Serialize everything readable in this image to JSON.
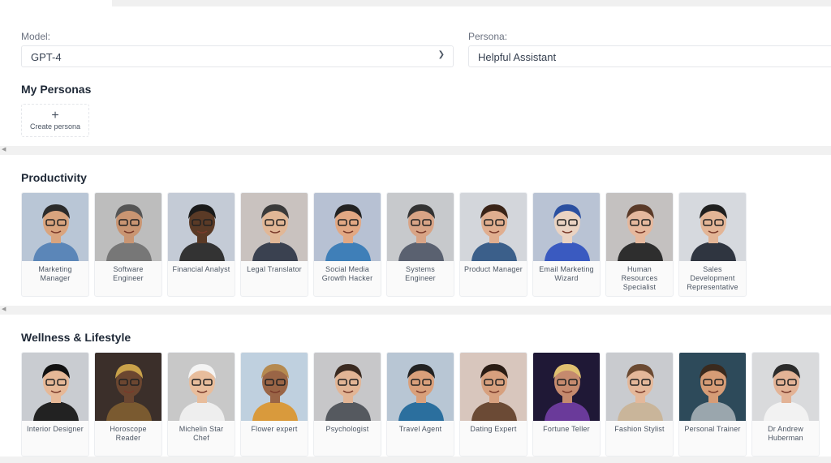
{
  "model": {
    "label": "Model:",
    "value": "GPT-4"
  },
  "persona": {
    "label": "Persona:",
    "value": "Helpful Assistant"
  },
  "my_personas": {
    "title": "My Personas",
    "create_label": "Create persona"
  },
  "sections": [
    {
      "title": "Productivity",
      "items": [
        {
          "name": "Marketing Manager",
          "bg": "#b9c6d6",
          "skin": "#d9a47e",
          "hair": "#2b2b2b",
          "shirt": "#5b86b8"
        },
        {
          "name": "Software Engineer",
          "bg": "#bdbdbd",
          "skin": "#c99572",
          "hair": "#555",
          "shirt": "#777"
        },
        {
          "name": "Financial Analyst",
          "bg": "#c4cbd6",
          "skin": "#5a3a26",
          "hair": "#1a1a1a",
          "shirt": "#333"
        },
        {
          "name": "Legal Translator",
          "bg": "#c9c2bf",
          "skin": "#e1b796",
          "hair": "#3a3a3a",
          "shirt": "#3a4150"
        },
        {
          "name": "Social Media Growth Hacker",
          "bg": "#b7c1d3",
          "skin": "#e2a883",
          "hair": "#222",
          "shirt": "#3f7fb8"
        },
        {
          "name": "Systems Engineer",
          "bg": "#c7c9cc",
          "skin": "#d8a486",
          "hair": "#333",
          "shirt": "#5a6170"
        },
        {
          "name": "Product Manager",
          "bg": "#d3d6db",
          "skin": "#e0ae8f",
          "hair": "#3a2418",
          "shirt": "#3b5f8a"
        },
        {
          "name": "Email Marketing Wizard",
          "bg": "#b9c3d4",
          "skin": "#ead3c2",
          "hair": "#2a4fa0",
          "shirt": "#3a5ac0"
        },
        {
          "name": "Human Resources Specialist",
          "bg": "#c4c1c0",
          "skin": "#e5b89d",
          "hair": "#5a3a28",
          "shirt": "#2e2e2e"
        },
        {
          "name": "Sales Development Representative",
          "bg": "#d6d9de",
          "skin": "#e3b596",
          "hair": "#1f1f1f",
          "shirt": "#2f3540"
        }
      ]
    },
    {
      "title": "Wellness & Lifestyle",
      "items": [
        {
          "name": "Interior Designer",
          "bg": "#c9ccd1",
          "skin": "#e6b897",
          "hair": "#111",
          "shirt": "#222"
        },
        {
          "name": "Horoscope Reader",
          "bg": "#3b2f2a",
          "skin": "#6b4630",
          "hair": "#c9a24a",
          "shirt": "#7a5a30"
        },
        {
          "name": "Michelin Star Chef",
          "bg": "#c8c8c8",
          "skin": "#e8bd9c",
          "hair": "#f4f4f4",
          "shirt": "#eeeeee"
        },
        {
          "name": "Flower expert",
          "bg": "#bfd0df",
          "skin": "#9a6546",
          "hair": "#b58a50",
          "shirt": "#d99a3c"
        },
        {
          "name": "Psychologist",
          "bg": "#c7c7c9",
          "skin": "#e2b595",
          "hair": "#3a2a20",
          "shirt": "#55595f"
        },
        {
          "name": "Travel Agent",
          "bg": "#b8c6d4",
          "skin": "#d9a07b",
          "hair": "#222",
          "shirt": "#2b6f9e"
        },
        {
          "name": "Dating Expert",
          "bg": "#d8c6bd",
          "skin": "#d7a07e",
          "hair": "#2a1c14",
          "shirt": "#6b4a35"
        },
        {
          "name": "Fortune Teller",
          "bg": "#1f1836",
          "skin": "#c58a6e",
          "hair": "#e0c070",
          "shirt": "#6a3a9a"
        },
        {
          "name": "Fashion Stylist",
          "bg": "#c9cbcf",
          "skin": "#e4b89a",
          "hair": "#6b4a32",
          "shirt": "#c9b59a"
        },
        {
          "name": "Personal Trainer",
          "bg": "#2d4a5a",
          "skin": "#d69c76",
          "hair": "#3a2a1e",
          "shirt": "#9aa6ad"
        },
        {
          "name": "Dr Andrew Huberman",
          "bg": "#d9dadc",
          "skin": "#e3b396",
          "hair": "#2b2b2b",
          "shirt": "#f2f2f2"
        }
      ]
    }
  ]
}
